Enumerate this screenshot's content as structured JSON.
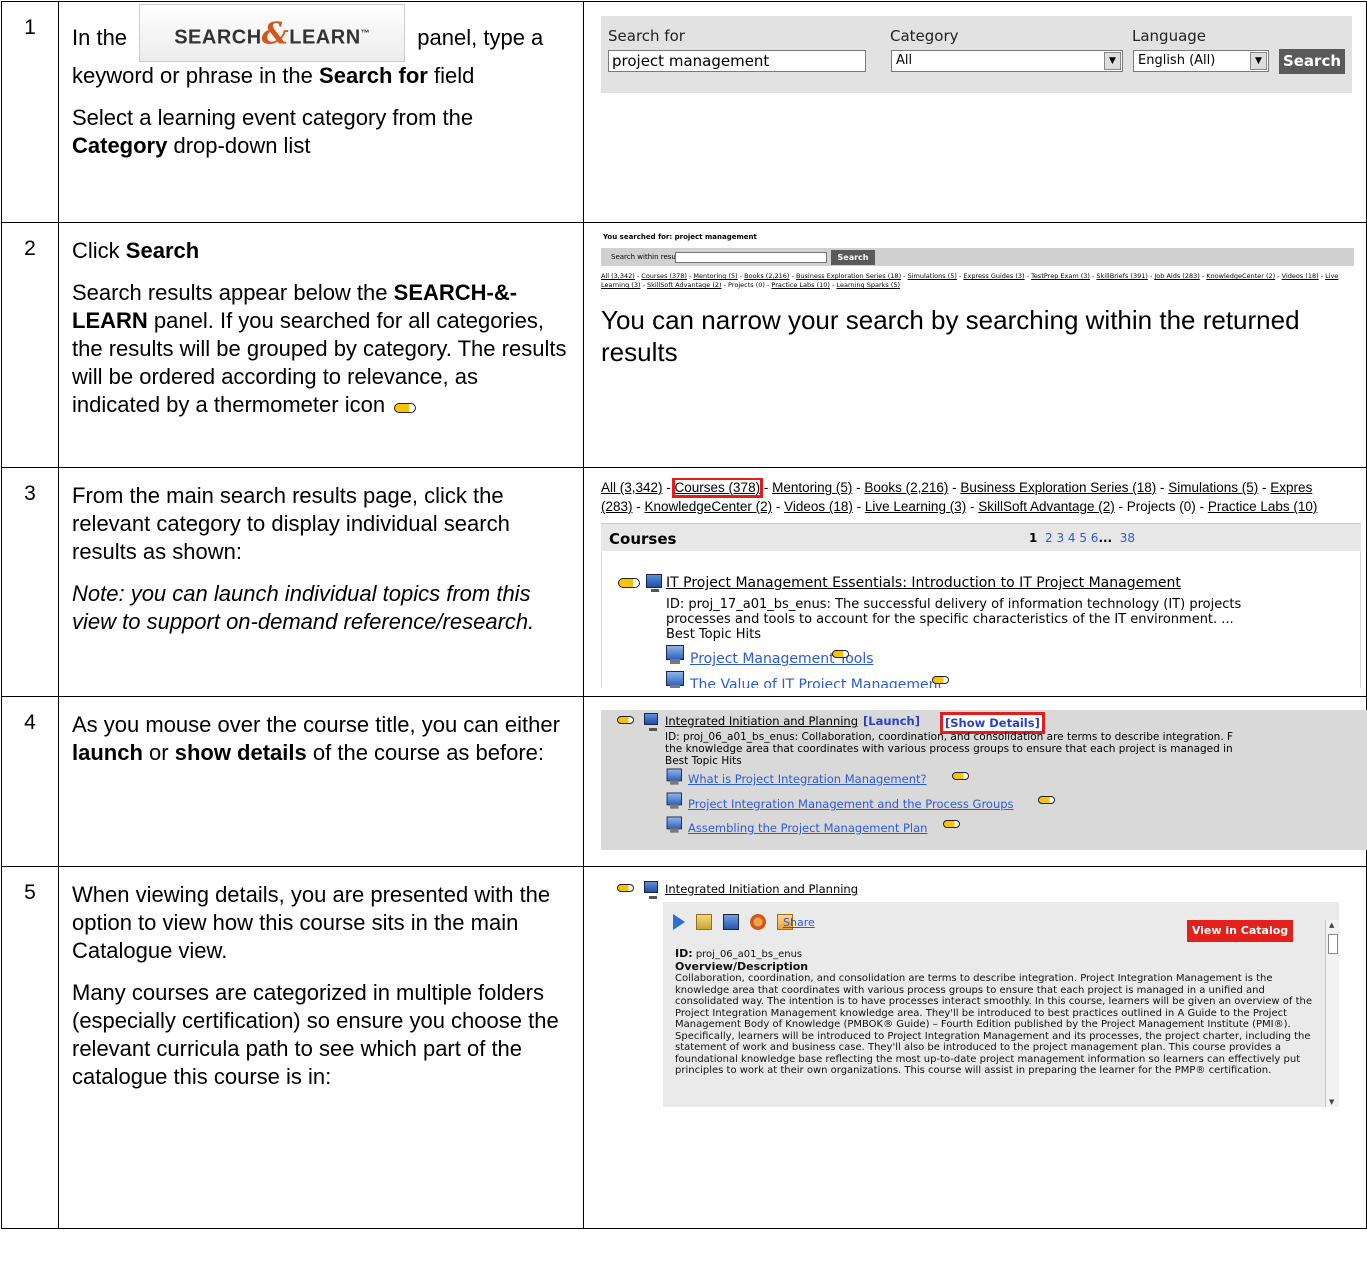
{
  "row1": {
    "num": "1",
    "logo": {
      "text_left": "SEARCH",
      "amp": "&",
      "text_right": "LEARN",
      "tm": "™"
    },
    "t1": "In the",
    "t2": "panel, type a keyword or phrase in the",
    "t2b": "Search for",
    "t2c": "field",
    "t3": "Select a learning event category from the",
    "t3b": "Category",
    "t3c": "drop-down list",
    "shot": {
      "search_for_label": "Search for",
      "search_for_value": "project management",
      "category_label": "Category",
      "category_value": "All",
      "language_label": "Language",
      "language_value": "English (All)",
      "search_button": "Search"
    }
  },
  "row2": {
    "num": "2",
    "t1a": "Click",
    "t1b": "Search",
    "t2a": "Search results appear below the",
    "t2b": "SEARCH-&-LEARN",
    "t2c": "panel. If you searched for all categories, the results will be grouped by category. The results will be ordered according to relevance, as indicated by a thermometer icon",
    "shot": {
      "you_searched": "You searched for: project management",
      "search_within": "Search within results",
      "search_button": "Search",
      "cats": [
        "All (3,342)",
        "Courses (378)",
        "Mentoring (5)",
        "Books (2,216)",
        "Business Exploration Series (18)",
        "Simulations (5)",
        "Express Guides (3)",
        "TestPrep Exam (3)",
        "SkillBriefs (391)",
        "Job Aids (283)",
        "KnowledgeCenter (2)",
        "Videos (18)",
        "Live Learning (3)",
        "SkillSoft Advantage (2)",
        "Projects (0)",
        "Practice Labs (10)",
        "Learning Sparks (5)"
      ],
      "narrow": "You can narrow your search by searching within the returned results"
    }
  },
  "row3": {
    "num": "3",
    "t1": "From the main search results page, click the relevant category to display individual search results as shown:",
    "t2": "Note: you can launch individual topics from this view to support on-demand reference/research.",
    "shot": {
      "cat_all": "All (3,342)",
      "cat_courses": "Courses (378)",
      "cat_line1_rest": [
        "Mentoring (5)",
        "Books (2,216)",
        "Business Exploration Series (18)",
        "Simulations (5)",
        "Expres"
      ],
      "cat_line2_first": "(283)",
      "cat_line2": [
        "KnowledgeCenter (2)",
        "Videos (18)",
        "Live Learning (3)",
        "SkillSoft Advantage (2)"
      ],
      "cat_projects": "Projects (0)",
      "cat_practice": "Practice Labs (10)",
      "header": "Courses",
      "page_current": "1",
      "pages": "2  3  4  5  6",
      "pages_ellipsis": "...",
      "pages_last": "38",
      "course_title": "IT Project Management Essentials: Introduction to IT Project Management",
      "desc1": "ID: proj_17_a01_bs_enus: The successful delivery of information technology (IT) projects",
      "desc2": "processes and tools to account for the specific characteristics of the IT environment. ...",
      "best_topic": "Best Topic Hits",
      "topic1": "Project Management Tools ",
      "topic2": "The Value of IT Project Management "
    }
  },
  "row4": {
    "num": "4",
    "t1a": "As you mouse over the course title, you can either",
    "t1b": "launch",
    "t1c": "or",
    "t1d": "show details",
    "t1e": "of the course as before:",
    "shot": {
      "course_title": "Integrated Initiation and Planning",
      "launch": "[Launch]",
      "show_details": "[Show Details]",
      "desc1": "ID: proj_06_a01_bs_enus: Collaboration, coordination, and consolidation are terms to describe integration. F",
      "desc2": "the knowledge area that coordinates with various process groups to ensure that each project is managed in",
      "best_topic": "Best Topic Hits",
      "topic1": "What is Project Integration Management? ",
      "topic2": "Project Integration Management and the Process Groups ",
      "topic3": "Assembling the Project Management Plan "
    }
  },
  "row5": {
    "num": "5",
    "t1": "When viewing details, you are presented with the option to view how this course sits in the main Catalogue view.",
    "t2": "Many courses are categorized in multiple folders (especially certification) so ensure you choose the relevant curricula path to see which part of the catalogue this course is in:",
    "shot": {
      "course_title": "Integrated Initiation and Planning",
      "share": "Share",
      "view_in_catalog": "View in Catalog",
      "id_label": "ID:",
      "id_value": "proj_06_a01_bs_enus",
      "overview_label": "Overview/Description",
      "description": "Collaboration, coordination, and consolidation are terms to describe integration. Project Integration Management is the knowledge area that coordinates with various process groups to ensure that each project is managed in a unified and consolidated way. The intention is to have processes interact smoothly. In this course, learners will be given an overview of the Project Integration Management knowledge area. They'll be introduced to best practices outlined in A Guide to the Project Management Body of Knowledge (PMBOK® Guide) – Fourth Edition published by the Project Management Institute (PMI®). Specifically, learners will be introduced to Project Integration Management and its processes, the project charter, including the statement of work and business case. They'll also be introduced to the project management plan. This course provides a foundational knowledge base reflecting the most up-to-date project management information so learners can effectively put principles to work at their own organizations. This course will assist in preparing the learner for the PMP® certification."
    }
  }
}
